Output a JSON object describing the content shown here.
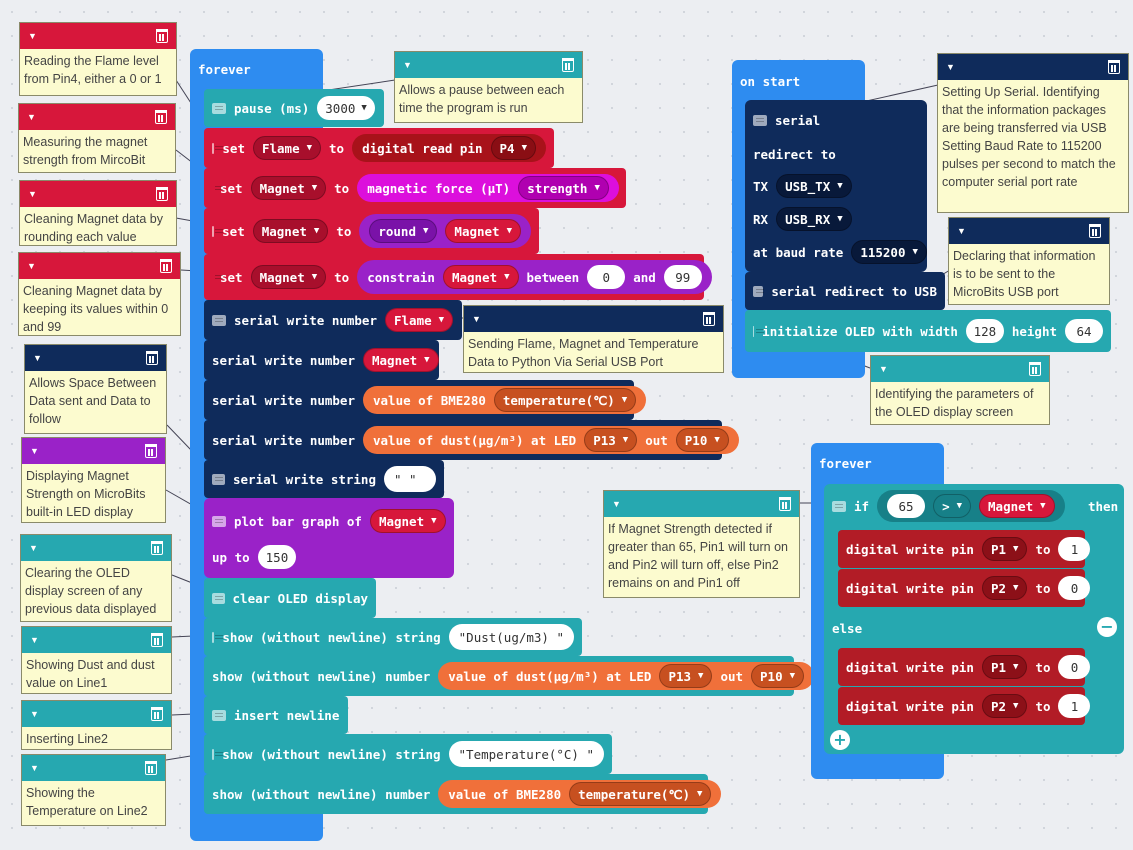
{
  "forever_main": {
    "hat": "forever",
    "pause": {
      "label": "pause (ms)",
      "value": "3000"
    },
    "set_flame": {
      "set": "set",
      "var": "Flame",
      "to": "to",
      "fn": "digital read pin",
      "pin": "P4"
    },
    "set_magnet_force": {
      "set": "set",
      "var": "Magnet",
      "to": "to",
      "fn": "magnetic force (µT)",
      "opt": "strength"
    },
    "set_magnet_round": {
      "set": "set",
      "var": "Magnet",
      "to": "to",
      "fn": "round",
      "arg": "Magnet"
    },
    "set_magnet_constrain": {
      "set": "set",
      "var": "Magnet",
      "to": "to",
      "fn": "constrain",
      "arg": "Magnet",
      "between": "between",
      "low": "0",
      "and": "and",
      "high": "99"
    },
    "serial_flame": {
      "label": "serial write number",
      "arg": "Flame"
    },
    "serial_magnet": {
      "label": "serial write number",
      "arg": "Magnet"
    },
    "serial_temp": {
      "label": "serial write number",
      "fn": "value of BME280",
      "opt": "temperature(℃)"
    },
    "serial_dust": {
      "label": "serial write number",
      "fn": "value of dust(μg/m³) at LED",
      "led": "P13",
      "out": "out",
      "outpin": "P10"
    },
    "serial_string": {
      "label": "serial write string",
      "value": "\" \""
    },
    "plot": {
      "label": "plot bar graph of",
      "arg": "Magnet",
      "upto": "up to",
      "max": "150"
    },
    "clear_oled": {
      "label": "clear OLED display"
    },
    "show_dust_str": {
      "label": "show (without newline) string",
      "value": "\"Dust(ug/m3) \""
    },
    "show_dust_num": {
      "label": "show (without newline) number",
      "fn": "value of dust(μg/m³) at LED",
      "led": "P13",
      "out": "out",
      "outpin": "P10"
    },
    "newline": {
      "label": "insert newline"
    },
    "show_temp_str": {
      "label": "show (without newline) string",
      "value": "\"Temperature(°C) \""
    },
    "show_temp_num": {
      "label": "show (without newline) number",
      "fn": "value of BME280",
      "opt": "temperature(℃)"
    }
  },
  "on_start": {
    "hat": "on start",
    "serial": "serial",
    "redirect": "redirect to",
    "tx": "TX",
    "tx_val": "USB_TX",
    "rx": "RX",
    "rx_val": "USB_RX",
    "baud": "at baud rate",
    "baud_val": "115200",
    "redirect_usb": "serial redirect to USB",
    "oled": {
      "label": "initialize OLED with width",
      "width": "128",
      "height_label": "height",
      "height": "64"
    }
  },
  "forever_2": {
    "hat": "forever",
    "if": "if",
    "num": "65",
    "op": ">",
    "var": "Magnet",
    "then": "then",
    "else": "else",
    "dw": "digital write pin",
    "to": "to",
    "then_rows": [
      {
        "pin": "P1",
        "val": "1"
      },
      {
        "pin": "P2",
        "val": "0"
      }
    ],
    "else_rows": [
      {
        "pin": "P1",
        "val": "0"
      },
      {
        "pin": "P2",
        "val": "1"
      }
    ]
  },
  "comments": {
    "flame": "Reading the Flame level from Pin4, either a 0 or 1",
    "magnet_strength": "Measuring the magnet strength from MircoBit",
    "round": "Cleaning Magnet data by rounding each value",
    "constrain": "Cleaning Magnet data by keeping its values within 0 and 99",
    "space": "Allows Space Between Data sent and Data to follow",
    "plot": "Displaying Magnet Strength on MicroBits built-in LED display",
    "clear": "Clearing the OLED display screen of any previous data displayed",
    "dust": "Showing Dust and dust value on Line1",
    "line2": "Inserting Line2",
    "temp": "Showing the Temperature on Line2",
    "pause": "Allows a pause between each time the program is run",
    "send": "Sending Flame, Magnet and Temperature Data to Python Via Serial USB Port",
    "serial_setup": "Setting Up Serial. Identifying that the information packages are being transferred via USB Setting Baud Rate to 115200 pulses per second to match the computer serial port rate",
    "usb": "Declaring that information is to be sent to the MicroBits USB port",
    "oled": "Identifying the parameters of the OLED display screen",
    "if": "If Magnet Strength detected if greater than 65, Pin1 will turn on and Pin2 will turn off, else Pin2 remains on and Pin1 off"
  },
  "colors": {
    "variables": "#d7173b",
    "serial": "#0f2b5b",
    "input": "#dc0fdc",
    "math": "#9a22c8",
    "sensor": "#f0703a",
    "oled": "#26a8b0",
    "loops": "#2e8cf0",
    "pins": "#b21c26",
    "logic": "#26a8b0",
    "comment_bg": "#fcfbcf"
  },
  "icons": [
    "comment-icon",
    "trash-icon",
    "dropdown-arrow-icon",
    "minus-icon",
    "plus-icon"
  ]
}
